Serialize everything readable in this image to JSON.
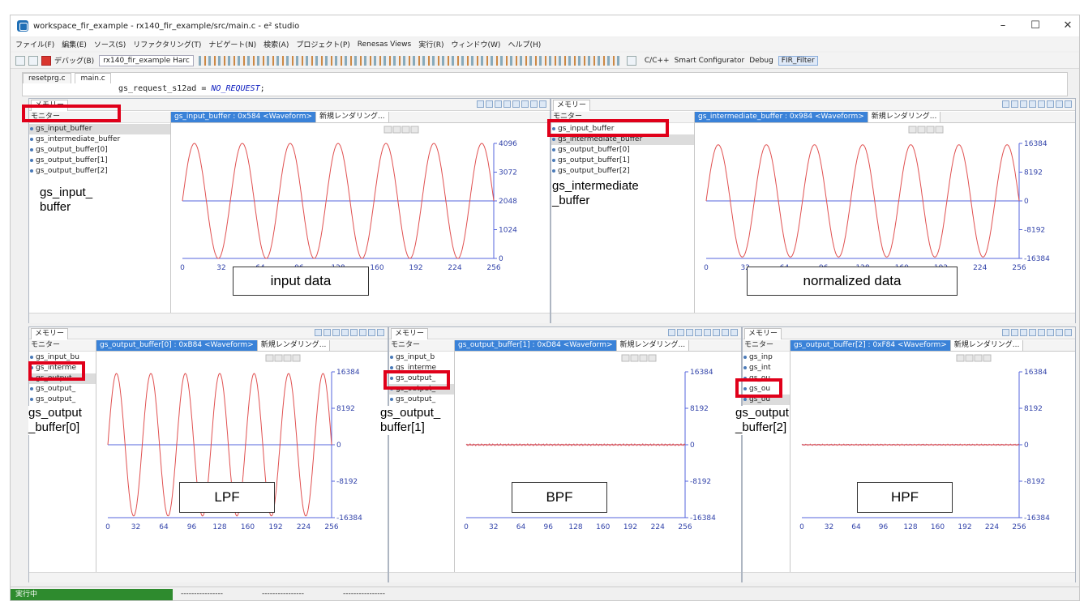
{
  "window": {
    "title": "workspace_fir_example - rx140_fir_example/src/main.c - e² studio",
    "controls": {
      "minimize": "–",
      "maximize": "☐",
      "close": "✕"
    }
  },
  "menu": [
    "ファイル(F)",
    "編集(E)",
    "ソース(S)",
    "リファクタリング(T)",
    "ナビゲート(N)",
    "検索(A)",
    "プロジェクト(P)",
    "Renesas Views",
    "実行(R)",
    "ウィンドウ(W)",
    "ヘルプ(H)"
  ],
  "toolbar": {
    "debug_label": "デバッグ(B)",
    "launch_config": "rx140_fir_example Harc",
    "perspectives": [
      "C/C++",
      "Smart Configurator",
      "Debug",
      "FIR_Filter"
    ]
  },
  "editor": {
    "tabs": [
      "resetprg.c",
      "main.c"
    ],
    "code_var": "gs_request_s12ad",
    "code_op": " = ",
    "code_val": "NO_REQUEST",
    "code_end": ";"
  },
  "panes": [
    {
      "view_tab": "メモリー",
      "monitor_label": "モニター",
      "items": [
        "gs_input_buffer",
        "gs_intermediate_buffer",
        "gs_output_buffer[0]",
        "gs_output_buffer[1]",
        "gs_output_buffer[2]"
      ],
      "selected_index": 0,
      "waveform_tab": "gs_input_buffer : 0x584 <Waveform>",
      "new_tab": "新規レンダリング...",
      "annotation": "gs_input_\nbuffer",
      "caption": "input data"
    },
    {
      "view_tab": "メモリー",
      "monitor_label": "モニター",
      "items": [
        "gs_input_buffer",
        "gs_intermediate_buffer",
        "gs_output_buffer[0]",
        "gs_output_buffer[1]",
        "gs_output_buffer[2]"
      ],
      "selected_index": 1,
      "waveform_tab": "gs_intermediate_buffer : 0x984 <Waveform>",
      "new_tab": "新規レンダリング...",
      "annotation": "gs_intermediate\n_buffer",
      "caption": "normalized data"
    },
    {
      "view_tab": "メモリー",
      "monitor_label": "モニター",
      "items": [
        "gs_input_bu",
        "gs_interme",
        "gs_output",
        "gs_output_",
        "gs_output_"
      ],
      "selected_index": 2,
      "waveform_tab": "gs_output_buffer[0] : 0xB84 <Waveform>",
      "new_tab": "新規レンダリング...",
      "annotation": "gs_output\n_buffer[0]",
      "caption": "LPF"
    },
    {
      "view_tab": "メモリー",
      "monitor_label": "モニター",
      "items": [
        "gs_input_b",
        "gs_interme",
        "gs_output_",
        "gs_output_",
        "gs_output_"
      ],
      "selected_index": 3,
      "waveform_tab": "gs_output_buffer[1] : 0xD84 <Waveform>",
      "new_tab": "新規レンダリング...",
      "annotation": "gs_output_\nbuffer[1]",
      "caption": "BPF"
    },
    {
      "view_tab": "メモリー",
      "monitor_label": "モニター",
      "items": [
        "gs_inp",
        "gs_int",
        "gs_ou",
        "gs_ou",
        "gs_ou"
      ],
      "selected_index": 4,
      "waveform_tab": "gs_output_buffer[2] : 0xF84 <Waveform>",
      "new_tab": "新規レンダリング...",
      "annotation": "gs_output\n_buffer[2]",
      "caption": "HPF"
    }
  ],
  "chart_data": [
    {
      "type": "line",
      "name": "input data",
      "x_ticks": [
        0,
        32,
        64,
        96,
        128,
        160,
        192,
        224,
        256
      ],
      "y_ticks": [
        0,
        1024,
        2048,
        3072,
        4096
      ],
      "ylim": [
        0,
        4096
      ],
      "xlim": [
        0,
        256
      ],
      "center": 2048,
      "amplitude": 2048,
      "cycles": 6.5,
      "colors": {
        "wave": "#e05050",
        "axis": "#5566dd"
      }
    },
    {
      "type": "line",
      "name": "normalized data",
      "x_ticks": [
        0,
        32,
        64,
        96,
        128,
        160,
        192,
        224,
        256
      ],
      "y_ticks": [
        -16384,
        -8192,
        0,
        8192,
        16384
      ],
      "ylim": [
        -16384,
        16384
      ],
      "xlim": [
        0,
        256
      ],
      "center": 0,
      "amplitude": 16000,
      "cycles": 6.5,
      "colors": {
        "wave": "#e05050",
        "axis": "#5566dd"
      }
    },
    {
      "type": "line",
      "name": "LPF",
      "x_ticks": [
        0,
        32,
        64,
        96,
        128,
        160,
        192,
        224,
        256
      ],
      "y_ticks": [
        -16384,
        -8192,
        0,
        8192,
        16384
      ],
      "ylim": [
        -16384,
        16384
      ],
      "xlim": [
        0,
        256
      ],
      "center": 0,
      "amplitude": 16000,
      "cycles": 6.5,
      "colors": {
        "wave": "#e05050",
        "axis": "#5566dd"
      }
    },
    {
      "type": "line",
      "name": "BPF",
      "x_ticks": [
        0,
        32,
        64,
        96,
        128,
        160,
        192,
        224,
        256
      ],
      "y_ticks": [
        -16384,
        -8192,
        0,
        8192,
        16384
      ],
      "ylim": [
        -16384,
        16384
      ],
      "xlim": [
        0,
        256
      ],
      "center": 0,
      "amplitude": 200,
      "cycles": 40,
      "colors": {
        "wave": "#e05050",
        "axis": "#5566dd"
      }
    },
    {
      "type": "line",
      "name": "HPF",
      "x_ticks": [
        0,
        32,
        64,
        96,
        128,
        160,
        192,
        224,
        256
      ],
      "y_ticks": [
        -16384,
        -8192,
        0,
        8192,
        16384
      ],
      "ylim": [
        -16384,
        16384
      ],
      "xlim": [
        0,
        256
      ],
      "center": 0,
      "amplitude": 150,
      "cycles": 45,
      "colors": {
        "wave": "#e05050",
        "axis": "#5566dd"
      }
    }
  ],
  "status": {
    "running": "実行中",
    "seg1": "----------------",
    "seg2": "----------------",
    "seg3": "----------------"
  },
  "colors": {
    "highlight": "#e0001a",
    "accent": "#3a82d8",
    "run": "#2e8b2e"
  }
}
